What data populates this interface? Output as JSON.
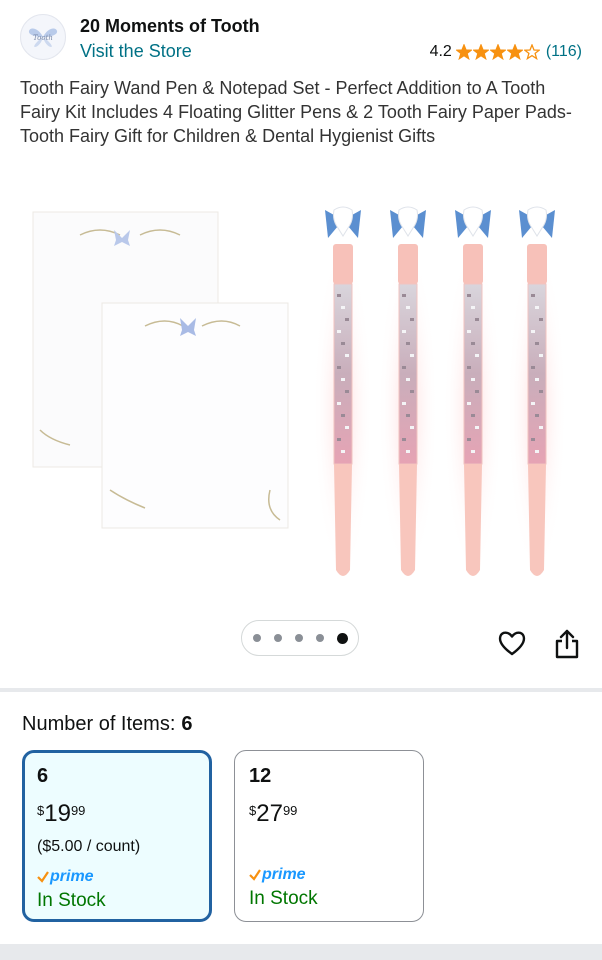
{
  "store": {
    "name": "20 Moments of Tooth",
    "visit_label": "Visit the Store",
    "logo_text": "Tooth"
  },
  "rating": {
    "value": "4.2",
    "stars": 4.2,
    "count": "(116)",
    "star_color": "#f79110"
  },
  "product": {
    "title": "Tooth Fairy Wand Pen & Notepad Set - Perfect Addition to A Tooth Fairy Kit Includes 4 Floating Glitter Pens & 2 Tooth Fairy Paper Pads- Tooth Fairy Gift for Children & Dental Hygienist Gifts",
    "image_icon": "product-photo",
    "pen_count": 4,
    "notepad_count": 2
  },
  "carousel": {
    "total": 5,
    "active_index": 4
  },
  "actions": {
    "heart_icon": "heart-icon",
    "share_icon": "share-icon"
  },
  "variation": {
    "label": "Number of Items:",
    "selected_value": "6",
    "options": [
      {
        "qty": "6",
        "currency": "$",
        "whole": "19",
        "cents": "99",
        "unit_price": "($5.00 / count)",
        "prime": "prime",
        "stock": "In Stock",
        "selected": true
      },
      {
        "qty": "12",
        "currency": "$",
        "whole": "27",
        "cents": "99",
        "unit_price": "",
        "prime": "prime",
        "stock": "In Stock",
        "selected": false
      }
    ]
  },
  "colors": {
    "link": "#007185",
    "selected_border": "#2162a1",
    "selected_bg": "#edfdff",
    "in_stock": "#007600",
    "prime": "#1a98ff"
  }
}
